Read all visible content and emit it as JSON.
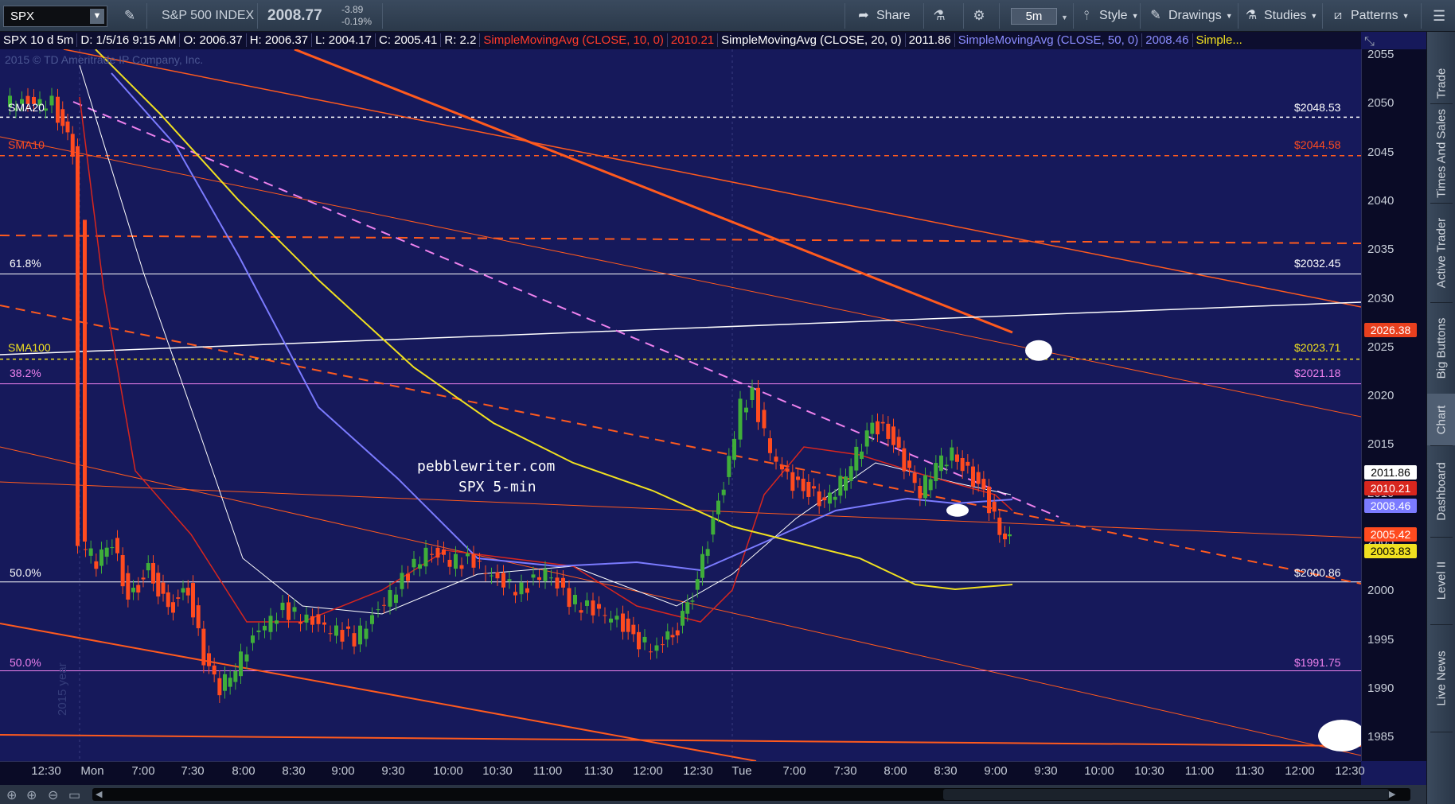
{
  "toolbar": {
    "symbol": "SPX",
    "index_name": "S&P 500 INDEX",
    "last_price": "2008.77",
    "change": "-3.89",
    "change_pct": "-0.19%",
    "share_label": "Share",
    "timeframe": "5m",
    "style_label": "Style",
    "drawings_label": "Drawings",
    "studies_label": "Studies",
    "patterns_label": "Patterns"
  },
  "header": {
    "chart_desc": "SPX 10 d 5m",
    "date": "D: 1/5/16 9:15 AM",
    "open": "O: 2006.37",
    "high": "H: 2006.37",
    "low": "L: 2004.17",
    "close": "C: 2005.41",
    "range": "R: 2.2",
    "sma10_label": "SimpleMovingAvg (CLOSE, 10, 0)",
    "sma10_val": "2010.21",
    "sma20_label": "SimpleMovingAvg (CLOSE, 20, 0)",
    "sma20_val": "2011.86",
    "sma50_label": "SimpleMovingAvg (CLOSE, 50, 0)",
    "sma50_val": "2008.46",
    "more": "Simple..."
  },
  "copyright": "2015 © TD Ameritrade IP Company, Inc.",
  "watermark": {
    "line1": "pebblewriter.com",
    "line2": "SPX 5-min"
  },
  "year_label": "2015 year",
  "levels": {
    "sma20": {
      "label": "SMA20",
      "value": "$2048.53"
    },
    "sma10": {
      "label": "SMA10",
      "value": "$2044.58"
    },
    "fib618": {
      "label": "61.8%",
      "value": "$2032.45"
    },
    "sma100": {
      "label": "SMA100",
      "value": "$2023.71"
    },
    "fib382": {
      "label": "38.2%",
      "value": "$2021.18"
    },
    "fib50a": {
      "label": "50.0%",
      "value": "$2000.86"
    },
    "fib50b": {
      "label": "50.0%",
      "value": "$1991.75"
    }
  },
  "y_axis": [
    "2055",
    "2050",
    "2045",
    "2040",
    "2035",
    "2030",
    "2025",
    "2020",
    "2015",
    "2010",
    "2005",
    "2000",
    "1995",
    "1990",
    "1985"
  ],
  "price_pills": {
    "p1": "2026.38",
    "p2": "2011.86",
    "p3": "2010.21",
    "p4": "2008.46",
    "p5": "2005.42",
    "p6": "2003.83"
  },
  "x_axis": [
    "12:30",
    "Mon",
    "7:00",
    "7:30",
    "8:00",
    "8:30",
    "9:00",
    "9:30",
    "10:00",
    "10:30",
    "11:00",
    "11:30",
    "12:00",
    "12:30",
    "Tue",
    "7:00",
    "7:30",
    "8:00",
    "8:30",
    "9:00",
    "9:30",
    "10:00",
    "10:30",
    "11:00",
    "11:30",
    "12:00",
    "12:30"
  ],
  "right_tabs": [
    "Trade",
    "Times And Sales",
    "Active Trader",
    "Big Buttons",
    "Chart",
    "Dashboard",
    "Level II",
    "Live News"
  ],
  "colors": {
    "background": "#16195b",
    "up": "#3fae3a",
    "down": "#ff4b1f",
    "sma10": "#d8261e",
    "sma20": "#ffffff",
    "sma50": "#7b7bff",
    "sma100": "#f0e020",
    "trend_pink": "#ee82ee",
    "trend_orange": "#ff5a1e"
  }
}
